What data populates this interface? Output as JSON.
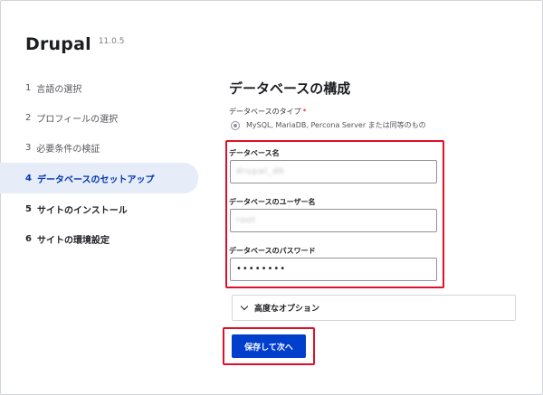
{
  "app": {
    "name": "Drupal",
    "version": "11.0.5"
  },
  "steps": [
    {
      "num": "1",
      "label": "言語の選択",
      "state": "done"
    },
    {
      "num": "2",
      "label": "プロフィールの選択",
      "state": "done"
    },
    {
      "num": "3",
      "label": "必要条件の検証",
      "state": "done"
    },
    {
      "num": "4",
      "label": "データベースのセットアップ",
      "state": "active"
    },
    {
      "num": "5",
      "label": "サイトのインストール",
      "state": "todo"
    },
    {
      "num": "6",
      "label": "サイトの環境設定",
      "state": "todo"
    }
  ],
  "form": {
    "title": "データベースの構成",
    "db_type_label": "データベースのタイプ",
    "required_mark": "*",
    "db_type_option": "MySQL, MariaDB, Percona Server または同等のもの",
    "db_name_label": "データベース名",
    "db_name_value": "drupal_db",
    "db_user_label": "データベースのユーザー名",
    "db_user_value": "root",
    "db_pass_label": "データベースのパスワード",
    "db_pass_value": "••••••••",
    "advanced_label": "高度なオプション",
    "submit_label": "保存して次へ"
  },
  "colors": {
    "accent": "#003ecc",
    "active_step_bg": "#e6ecf8",
    "active_step_text": "#0036b1",
    "highlight": "#e0102a"
  }
}
